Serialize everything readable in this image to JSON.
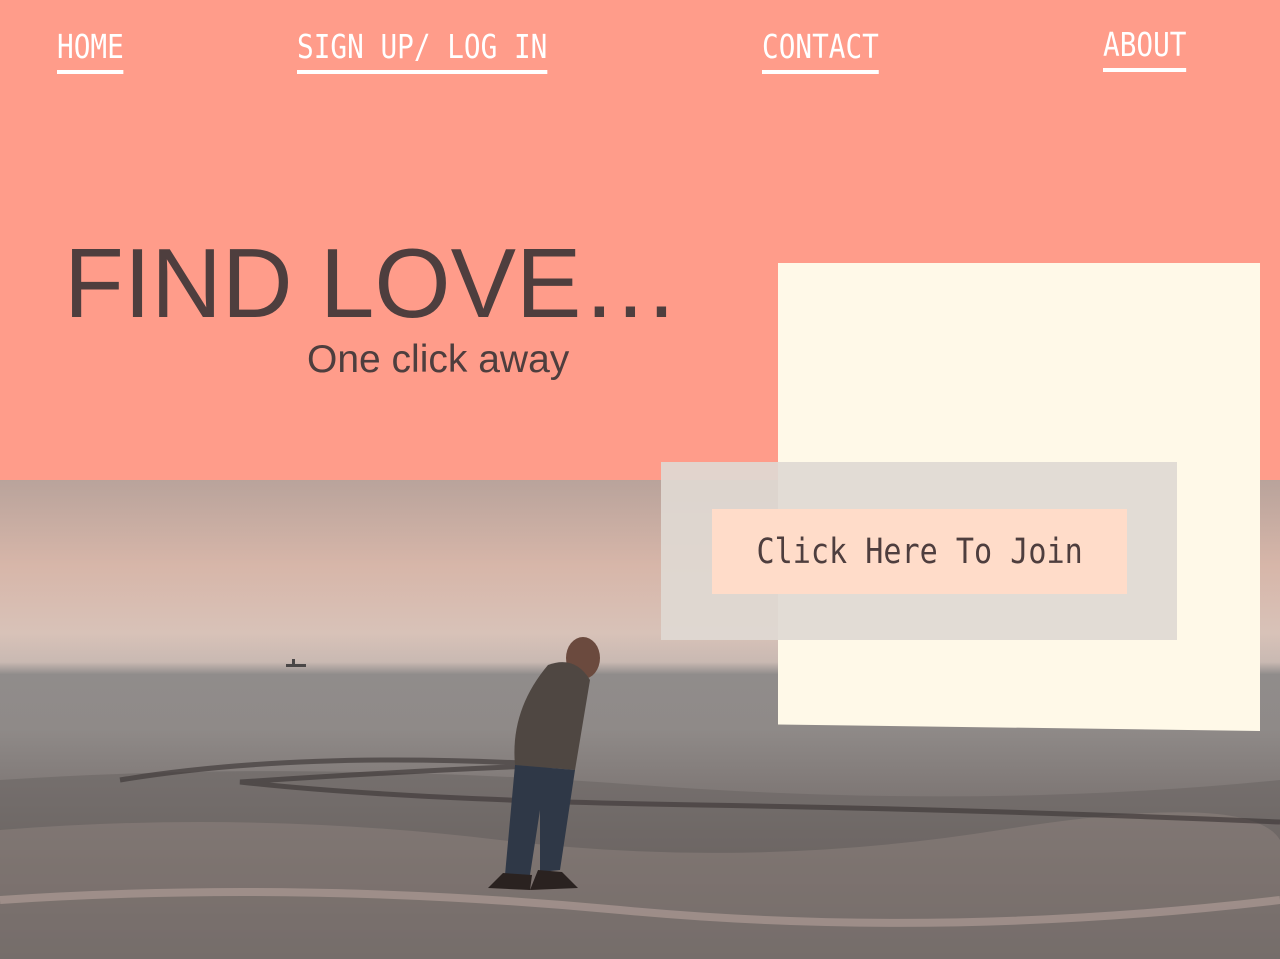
{
  "nav": {
    "home": "HOME",
    "signup": "SIGN UP/ LOG IN",
    "contact": "CONTACT",
    "about": "ABOUT"
  },
  "hero": {
    "title": "FIND LOVE…",
    "subtitle": "One click away"
  },
  "cta": {
    "label": "Click Here To Join"
  },
  "colors": {
    "header_bg": "#ff9c8a",
    "text_dark": "#4e3e3e",
    "panel": "#fff9e8",
    "button_bg": "#ffdcc9"
  }
}
